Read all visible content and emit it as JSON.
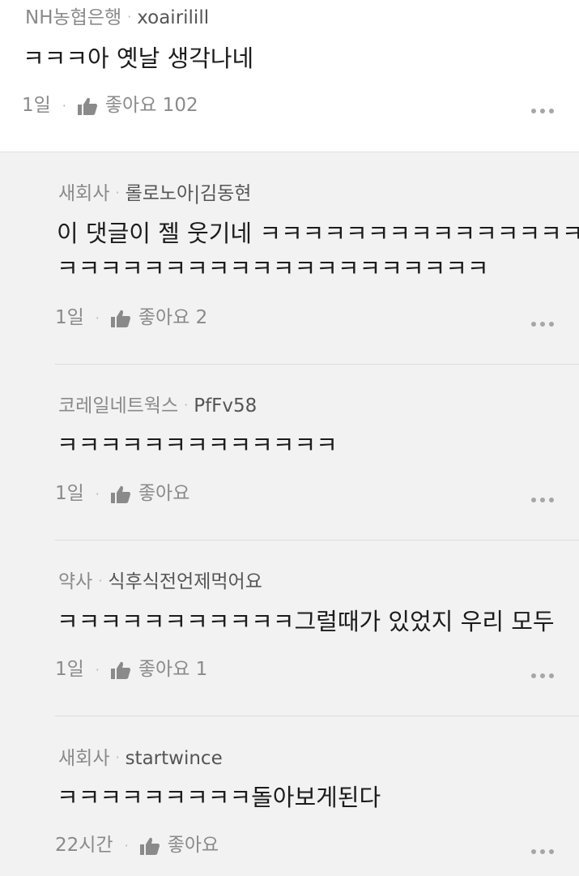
{
  "comments": [
    {
      "source": "NH농협은행",
      "author": "xoairilill",
      "text": "ㅋㅋㅋ아 옛날 생각나네",
      "time": "1일",
      "like_label": "좋아요 102"
    }
  ],
  "replies": [
    {
      "source": "새회사",
      "author": "롤로노아|김동현",
      "text_line1": "이 댓글이 젤 웃기네 ㅋㅋㅋㅋㅋㅋㅋㅋㅋㅋㅋㅋㅋㅋㅋㅋ",
      "text_line2": "ㅋㅋㅋㅋㅋㅋㅋㅋㅋㅋㅋㅋㅋㅋㅋㅋㅋㅋㅋㅋ",
      "time": "1일",
      "like_label": "좋아요 2"
    },
    {
      "source": "코레일네트웍스",
      "author": "PfFv58",
      "text_line1": "ㅋㅋㅋㅋㅋㅋㅋㅋㅋㅋㅋㅋㅋ",
      "time": "1일",
      "like_label": "좋아요"
    },
    {
      "source": "약사",
      "author": "식후식전언제먹어요",
      "text_line1": "ㅋㅋㅋㅋㅋㅋㅋㅋㅋㅋㅋ그럴때가 있었지 우리 모두",
      "time": "1일",
      "like_label": "좋아요 1"
    },
    {
      "source": "새회사",
      "author": "startwince",
      "text_line1": "ㅋㅋㅋㅋㅋㅋㅋㅋㅋ돌아보게된다",
      "time": "22시간",
      "like_label": "좋아요"
    }
  ],
  "meta_separator": "·",
  "icons": {
    "like": "thumbs-up-icon",
    "more": "more-options-icon"
  },
  "colors": {
    "top_background": "#ffffff",
    "reply_background": "#f2f2f2",
    "text": "#1c1c1c",
    "muted": "#8a8a8a"
  }
}
